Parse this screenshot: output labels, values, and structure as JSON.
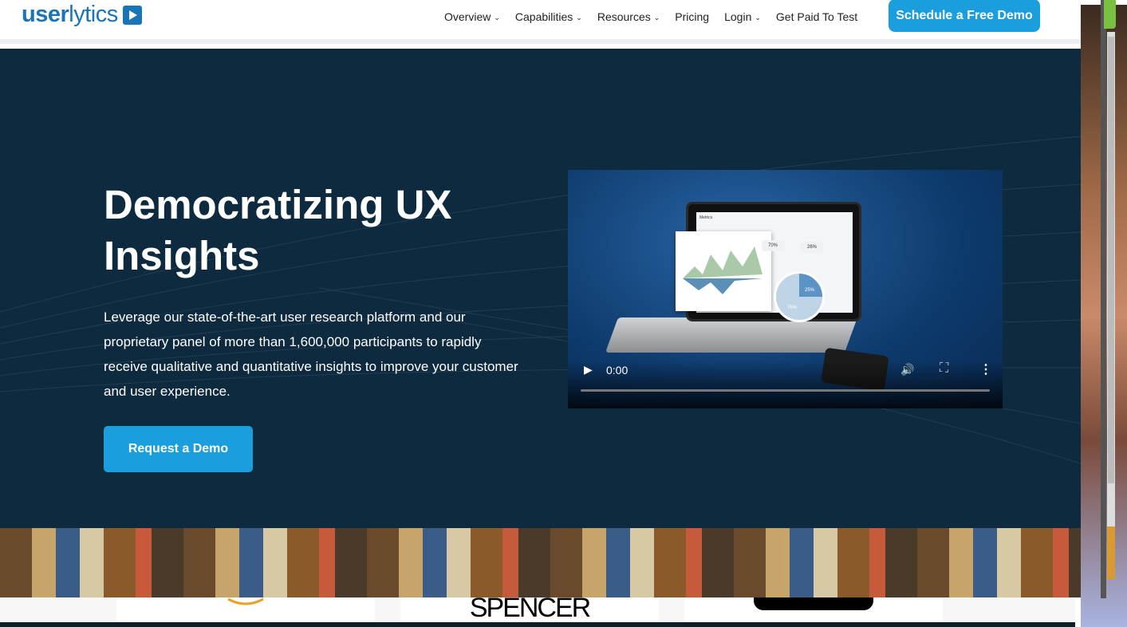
{
  "header": {
    "logo": {
      "bold": "user",
      "light": "lytics"
    },
    "nav": [
      {
        "label": "Overview",
        "dropdown": true
      },
      {
        "label": "Capabilities",
        "dropdown": true
      },
      {
        "label": "Resources",
        "dropdown": true
      },
      {
        "label": "Pricing",
        "dropdown": false
      },
      {
        "label": "Login",
        "dropdown": true
      },
      {
        "label": "Get Paid To Test",
        "dropdown": false
      }
    ],
    "cta": "Schedule a Free Demo"
  },
  "hero": {
    "title": "Democratizing UX Insights",
    "description": "Leverage our state-of-the-art user research platform and our proprietary panel of more than 1,600,000 participants to rapidly receive qualitative and quantitative insights to improve your customer and user experience.",
    "button": "Request a Demo",
    "video": {
      "time": "0:00",
      "progress": 0,
      "screen_title": "Metrics",
      "stat1": "70%",
      "stat2": "26%",
      "pie_a": "25%",
      "pie_b": "75%"
    }
  },
  "logos": [
    "SPENCER"
  ],
  "colors": {
    "accent": "#1b9ede",
    "hero_bg": "#0e2a3f",
    "brand": "#1a74b8"
  }
}
